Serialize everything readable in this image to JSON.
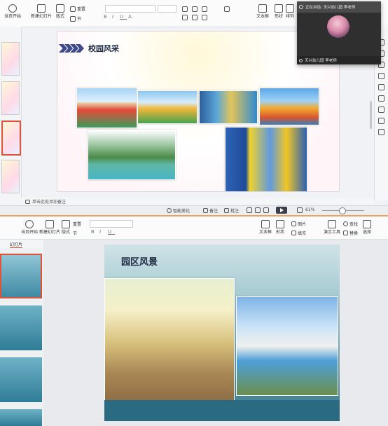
{
  "window1": {
    "ribbon": {
      "play_label": "当页开始",
      "new_slide_label": "新建幻灯片",
      "layout_label": "版式",
      "section_label": "节",
      "reset_label": "重置",
      "text_box_label": "文本框",
      "shape_label": "形状",
      "arrange_label": "排列"
    },
    "slide": {
      "title": "校园风采"
    },
    "notes_placeholder": "单击此处添加备注",
    "status": {
      "smart_beautify": "智能美化",
      "notes": "备注",
      "comments": "批注",
      "zoom": "61%"
    }
  },
  "video_call": {
    "header": "正在讲话: 天兴幼儿园 李老师",
    "footer_name": "天兴幼儿园 李老师"
  },
  "window2": {
    "ribbon": {
      "play_label": "当页开始",
      "new_slide_label": "新建幻灯片",
      "layout_label": "版式",
      "section_label": "节",
      "reset_label": "重置",
      "text_box_label": "文本框",
      "shape_label": "形状",
      "image_label": "图片",
      "fill_label": "填充",
      "present_tool_label": "演示工具",
      "find_label": "查找",
      "replace_label": "替换",
      "select_label": "选择"
    },
    "panel_tab": "幻灯片",
    "slide": {
      "title": "园区风景"
    }
  },
  "colors": {
    "accent": "#e0533b",
    "title_dark": "#1f2a44",
    "chevron": "#3d4b8c"
  }
}
